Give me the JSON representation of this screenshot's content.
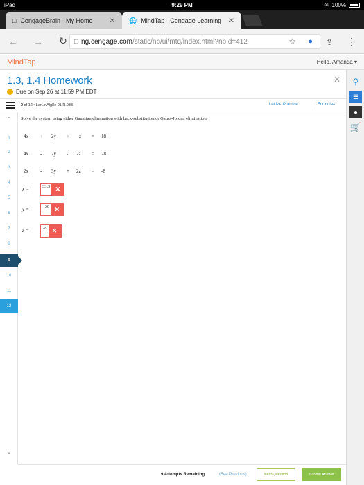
{
  "status": {
    "device": "iPad",
    "time": "9:29 PM",
    "battery": "100%"
  },
  "tabs": [
    {
      "label": "CengageBrain - My Home",
      "active": false
    },
    {
      "label": "MindTap - Cengage Learning",
      "active": true
    }
  ],
  "omnibox": {
    "host": "ng.cengage.com",
    "path": "/static/nb/ui/mtq/index.html?nbId=412"
  },
  "mindtap": {
    "logo": "MindTap",
    "greeting": "Hello, Amanda ▾"
  },
  "activity": {
    "title": "1.3, 1.4 Homework",
    "due": "Due on Sep 26 at 11:59 PM EDT"
  },
  "question_bar": {
    "position": "9",
    "of": "of 12 • LarLinAlg8e 01.R.033.",
    "let_me_practice": "Let Me Practice",
    "formulas": "Formulas"
  },
  "rail": {
    "items": [
      "1",
      "2",
      "3",
      "4",
      "5",
      "6",
      "7",
      "8",
      "9",
      "10",
      "11",
      "12"
    ],
    "current": "9"
  },
  "question": {
    "prompt": "Solve the system using either Gaussian elimination with back-substitution or Gauss-Jordan elimination.",
    "equations": [
      {
        "t1": "4x",
        "o1": "+",
        "t2": "2y",
        "o2": "+",
        "t3": "z",
        "eq": "=",
        "rhs": "18"
      },
      {
        "t1": "4x",
        "o1": "-",
        "t2": "2y",
        "o2": "-",
        "t3": "2z",
        "eq": "=",
        "rhs": "28"
      },
      {
        "t1": "2x",
        "o1": "-",
        "t2": "3y",
        "o2": "+",
        "t3": "2z",
        "eq": "=",
        "rhs": "-8"
      }
    ],
    "answers": [
      {
        "var": "x =",
        "value": "33.5"
      },
      {
        "var": "y =",
        "value": "−30"
      },
      {
        "var": "z =",
        "value": "28"
      }
    ]
  },
  "footer": {
    "attempts": "9 Attempts Remaining",
    "prev": "(See Previous)",
    "next": "Next Question",
    "submit": "Submit Answer"
  }
}
